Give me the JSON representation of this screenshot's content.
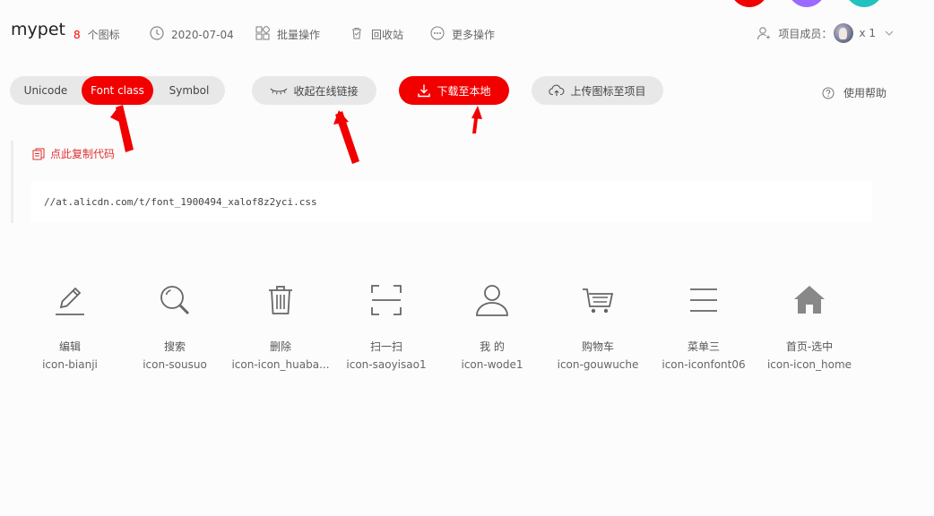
{
  "colors": {
    "accent": "#f20000",
    "circle_1": "#f20000",
    "circle_2": "#9b6bff",
    "circle_3": "#21c3c0",
    "copy_link": "#e12f2f",
    "annotation_arrow": "#f20000"
  },
  "header": {
    "title": "mypet",
    "icon_count": "8",
    "icon_count_label": "个图标",
    "date": "2020-07-04",
    "batch_label": "批量操作",
    "recycle_label": "回收站",
    "more_label": "更多操作",
    "members_label": "项目成员：",
    "members_count": "x 1",
    "icons": {
      "date": "clock-icon",
      "batch": "batch-grid-icon",
      "recycle": "trash-can-icon",
      "more": "more-dots-icon",
      "members": "user-icon",
      "dropdown": "chevron-down-icon"
    }
  },
  "toolbar": {
    "tabs": [
      {
        "label": "Unicode",
        "selected": false
      },
      {
        "label": "Font class",
        "selected": true
      },
      {
        "label": "Symbol",
        "selected": false
      }
    ],
    "collapse_label": "收起在线链接",
    "download_label": "下载至本地",
    "upload_label": "上传图标至项目",
    "help_label": "使用帮助",
    "icons": {
      "collapse": "closed-eye-icon",
      "download": "download-icon",
      "upload": "cloud-upload-icon",
      "help": "question-circle-icon"
    }
  },
  "code": {
    "copy_label": "点此复制代码",
    "copy_icon": "copy-icon",
    "url": "//at.alicdn.com/t/font_1900494_xalof8z2yci.css"
  },
  "icons": [
    {
      "name": "编辑",
      "code": "icon-bianji",
      "glyph": "pencil-icon"
    },
    {
      "name": "搜索",
      "code": "icon-sousuo",
      "glyph": "search-icon"
    },
    {
      "name": "删除",
      "code": "icon-icon_huaba...",
      "glyph": "trash-icon"
    },
    {
      "name": "扫一扫",
      "code": "icon-saoyisao1",
      "glyph": "scan-icon"
    },
    {
      "name": "我 的",
      "code": "icon-wode1",
      "glyph": "user-icon"
    },
    {
      "name": "购物车",
      "code": "icon-gouwuche",
      "glyph": "cart-icon"
    },
    {
      "name": "菜单三",
      "code": "icon-iconfont06",
      "glyph": "menu-icon"
    },
    {
      "name": "首页-选中",
      "code": "icon-icon_home",
      "glyph": "home-icon"
    }
  ]
}
